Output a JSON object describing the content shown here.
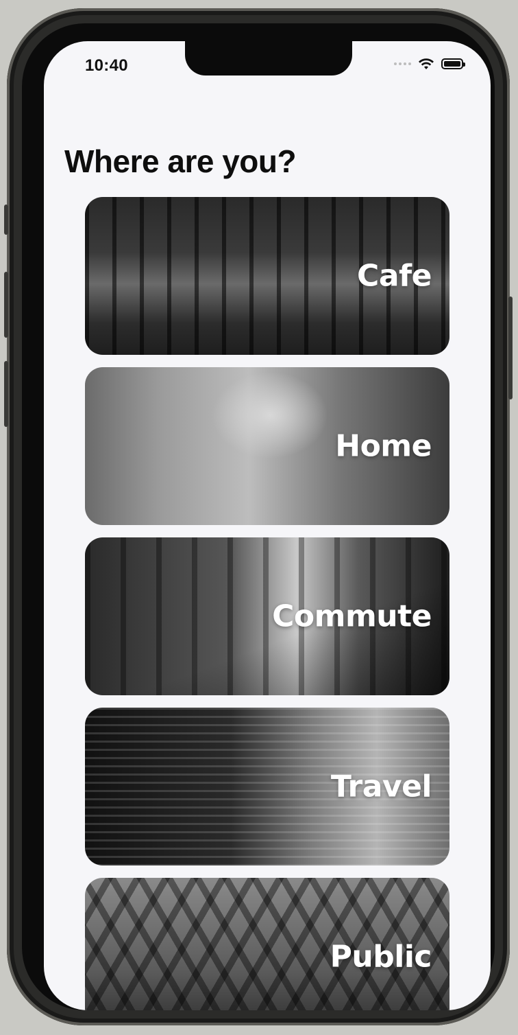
{
  "status_bar": {
    "time": "10:40",
    "icons": [
      "signal-dots-icon",
      "wifi-icon",
      "battery-icon"
    ]
  },
  "header": {
    "title": "Where are you?"
  },
  "locations": [
    {
      "label": "Cafe",
      "image": "cafe-interior-photo"
    },
    {
      "label": "Home",
      "image": "home-office-photo"
    },
    {
      "label": "Commute",
      "image": "train-platform-photo"
    },
    {
      "label": "Travel",
      "image": "traveler-backpack-photo"
    },
    {
      "label": "Public",
      "image": "public-structure-photo"
    }
  ],
  "colors": {
    "background": "#f6f6f9",
    "title_text": "#0e0e0e",
    "card_label_text": "#ffffff"
  }
}
